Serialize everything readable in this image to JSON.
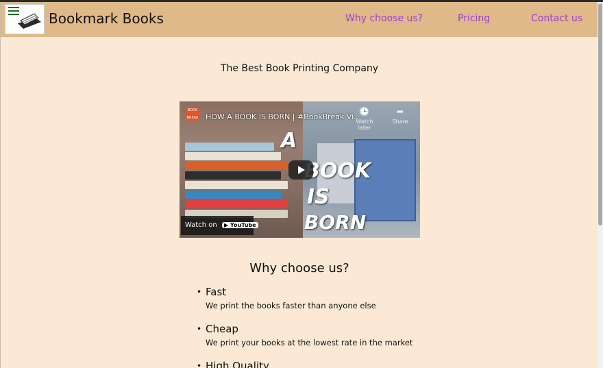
{
  "header": {
    "brand": "Bookmark Books",
    "nav": [
      "Why choose us?",
      "Pricing",
      "Contact us"
    ]
  },
  "hero": {
    "tagline": "The Best Book Printing Company"
  },
  "video": {
    "title": "HOW A BOOK IS BORN | #BookBreak Vi...",
    "channel_badge": "BOOK BREAK",
    "watch_later": "Watch later",
    "share": "Share",
    "watch_on": "Watch on",
    "youtube": "YouTube",
    "overlay_words": [
      "A",
      "BOOK",
      "IS",
      "BORN"
    ]
  },
  "features_section": {
    "title": "Why choose us?",
    "items": [
      {
        "name": "Fast",
        "desc": "We print the books faster than anyone else"
      },
      {
        "name": "Cheap",
        "desc": "We print your books at the lowest rate in the market"
      },
      {
        "name": "High Quality",
        "desc": ""
      }
    ]
  },
  "colors": {
    "header_bg": "#dfb988",
    "page_bg": "#fbe9d5",
    "nav_link": "#9b3fd6"
  }
}
